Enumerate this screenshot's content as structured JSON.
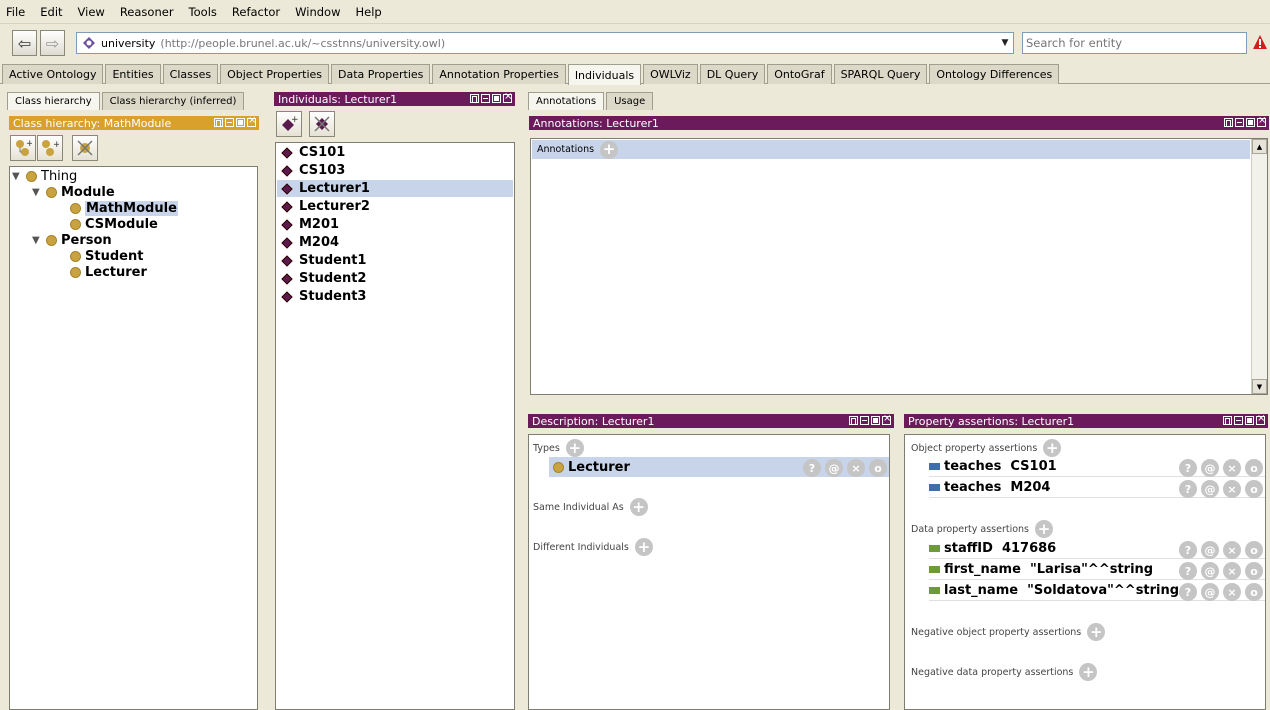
{
  "menu": [
    "File",
    "Edit",
    "View",
    "Reasoner",
    "Tools",
    "Refactor",
    "Window",
    "Help"
  ],
  "ontology": {
    "name": "university",
    "iri": "(http://people.brunel.ac.uk/~csstnns/university.owl)"
  },
  "search": {
    "placeholder": "Search for entity"
  },
  "tabs": [
    "Active Ontology",
    "Entities",
    "Classes",
    "Object Properties",
    "Data Properties",
    "Annotation Properties",
    "Individuals",
    "OWLViz",
    "DL Query",
    "OntoGraf",
    "SPARQL Query",
    "Ontology Differences"
  ],
  "active_tab": "Individuals",
  "class_pane": {
    "subtabs": [
      "Class hierarchy",
      "Class hierarchy (inferred)"
    ],
    "title": "Class hierarchy: MathModule",
    "tree": [
      {
        "label": "Thing",
        "level": 0
      },
      {
        "label": "Module",
        "level": 1
      },
      {
        "label": "MathModule",
        "level": 2,
        "selected": true
      },
      {
        "label": "CSModule",
        "level": 2
      },
      {
        "label": "Person",
        "level": 1
      },
      {
        "label": "Student",
        "level": 2
      },
      {
        "label": "Lecturer",
        "level": 2
      }
    ]
  },
  "individuals_pane": {
    "title": "Individuals: Lecturer1",
    "items": [
      "CS101",
      "CS103",
      "Lecturer1",
      "Lecturer2",
      "M201",
      "M204",
      "Student1",
      "Student2",
      "Student3"
    ],
    "selected": "Lecturer1"
  },
  "annotations_pane": {
    "subtabs": [
      "Annotations",
      "Usage"
    ],
    "title": "Annotations: Lecturer1",
    "header": "Annotations"
  },
  "description_pane": {
    "title": "Description: Lecturer1",
    "types_label": "Types",
    "type_value": "Lecturer",
    "same_label": "Same Individual As",
    "different_label": "Different Individuals"
  },
  "property_pane": {
    "title": "Property assertions: Lecturer1",
    "object_label": "Object property assertions",
    "object_assertions": [
      {
        "prop": "teaches",
        "value": "CS101"
      },
      {
        "prop": "teaches",
        "value": "M204"
      }
    ],
    "data_label": "Data property assertions",
    "data_assertions": [
      {
        "prop": "staffID",
        "value": "417686"
      },
      {
        "prop": "first_name",
        "value": "\"Larisa\"^^string"
      },
      {
        "prop": "last_name",
        "value": "\"Soldatova\"^^string"
      }
    ],
    "neg_object_label": "Negative object property assertions",
    "neg_data_label": "Negative data property assertions"
  },
  "colors": {
    "pane_title": "#6b1b5c",
    "class_title": "#d9a02c",
    "class_dot": "#c9a33e",
    "individual_diamond": "#5a1a4e",
    "selection": "#c7d4ea"
  }
}
